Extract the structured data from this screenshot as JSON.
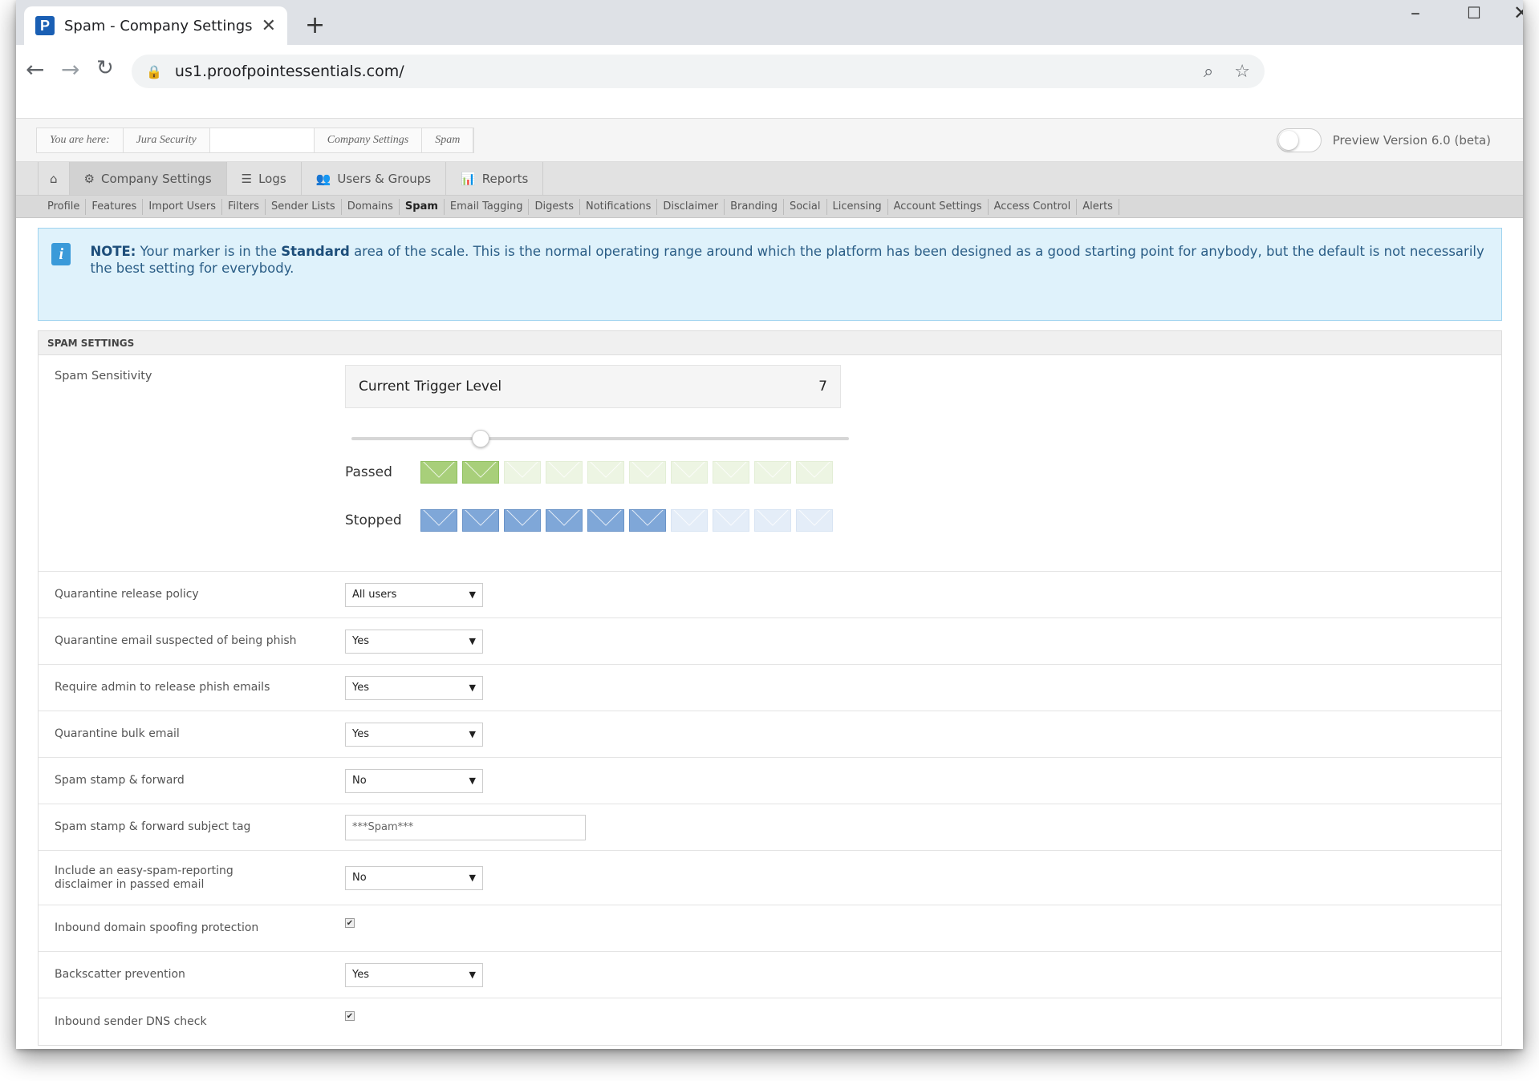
{
  "browser": {
    "tab_title": "Spam - Company Settings",
    "favicon_letter": "P",
    "url": "us1.proofpointessentials.com/"
  },
  "breadcrumb": {
    "items": [
      "You are here:",
      "Jura Security",
      "",
      "Company Settings",
      "Spam"
    ],
    "preview_label": "Preview Version 6.0 (beta)"
  },
  "main_nav": {
    "tabs": [
      {
        "label": "Company Settings",
        "icon": "gear-icon"
      },
      {
        "label": "Logs",
        "icon": "list-icon"
      },
      {
        "label": "Users & Groups",
        "icon": "users-icon"
      },
      {
        "label": "Reports",
        "icon": "chart-icon"
      }
    ]
  },
  "sub_nav": {
    "items": [
      "Profile",
      "Features",
      "Import Users",
      "Filters",
      "Sender Lists",
      "Domains",
      "Spam",
      "Email Tagging",
      "Digests",
      "Notifications",
      "Disclaimer",
      "Branding",
      "Social",
      "Licensing",
      "Account Settings",
      "Access Control",
      "Alerts"
    ],
    "active": "Spam"
  },
  "note": {
    "prefix": "NOTE:",
    "text_a": " Your marker is in the ",
    "emphasis": "Standard",
    "text_b": " area of the scale. This is the normal operating range around which the platform has been designed as a good starting point for anybody, but the default is not necessarily the best setting for everybody."
  },
  "panel": {
    "title": "SPAM SETTINGS",
    "sensitivity": {
      "label": "Spam Sensitivity",
      "trigger_label": "Current Trigger Level",
      "trigger_value": "7",
      "slider_fraction": 0.26,
      "passed_label": "Passed",
      "stopped_label": "Stopped",
      "passed_on": 2,
      "stopped_on": 6,
      "total_boxes": 10
    },
    "settings": [
      {
        "label": "Quarantine release policy",
        "type": "select",
        "value": "All users"
      },
      {
        "label": "Quarantine email suspected of being phish",
        "type": "select",
        "value": "Yes"
      },
      {
        "label": "Require admin to release phish emails",
        "type": "select",
        "value": "Yes"
      },
      {
        "label": "Quarantine bulk email",
        "type": "select",
        "value": "Yes"
      },
      {
        "label": "Spam stamp & forward",
        "type": "select",
        "value": "No"
      },
      {
        "label": "Spam stamp & forward subject tag",
        "type": "text",
        "value": "***Spam***"
      },
      {
        "label": "Include an easy-spam-reporting disclaimer in passed email",
        "type": "select",
        "value": "No"
      },
      {
        "label": "Inbound domain spoofing protection",
        "type": "checkbox",
        "value": "✔"
      },
      {
        "label": "Backscatter prevention",
        "type": "select",
        "value": "Yes"
      },
      {
        "label": "Inbound sender DNS check",
        "type": "checkbox",
        "value": "✔"
      }
    ]
  }
}
